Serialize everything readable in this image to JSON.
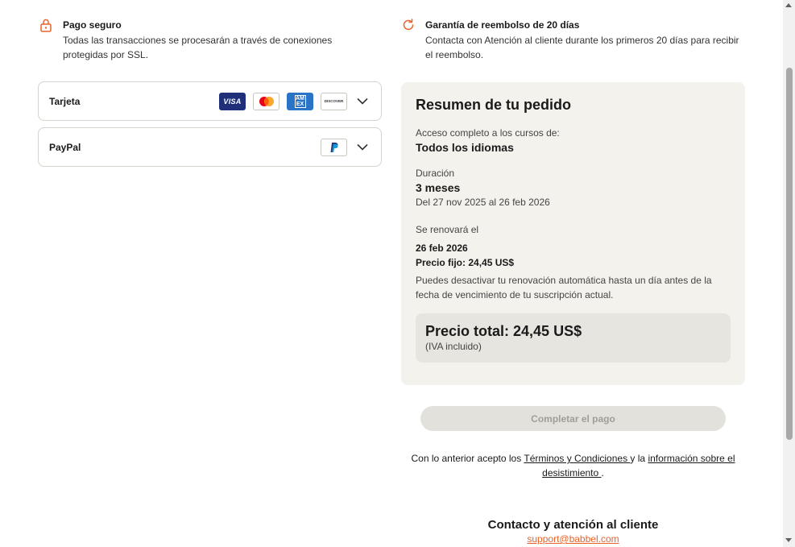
{
  "secure": {
    "title": "Pago seguro",
    "desc": "Todas las transacciones se procesarán a través de conexiones protegidas por SSL."
  },
  "refund": {
    "title": "Garantía de reembolso de 20 días",
    "desc": "Contacta con Atención al cliente durante los primeros 20 días para recibir el reembolso."
  },
  "payment_methods": [
    {
      "label": "Tarjeta",
      "icons": [
        "visa-icon",
        "mastercard-icon",
        "amex-icon",
        "discover-icon"
      ]
    },
    {
      "label": "PayPal",
      "icons": [
        "paypal-icon"
      ]
    }
  ],
  "card_logos": {
    "visa": "VISA",
    "amex": "AM EX",
    "discover": "DISCOVER"
  },
  "summary": {
    "title": "Resumen de tu pedido",
    "access_label": "Acceso completo a los cursos de:",
    "access_value": "Todos los idiomas",
    "duration_label": "Duración",
    "duration_value": "3 meses",
    "duration_dates": "Del 27 nov 2025 al 26 feb 2026",
    "renew_label": "Se renovará el",
    "renew_date": "26 feb 2026",
    "fixed_price": "Precio fijo: 24,45 US$",
    "renew_note": "Puedes desactivar tu renovación automática hasta un día antes de la fecha de vencimiento de tu suscripción actual.",
    "total": "Precio total: 24,45 US$",
    "vat": "(IVA incluido)"
  },
  "pay_button": "Completar el pago",
  "legal": {
    "prefix": "Con lo anterior acepto los ",
    "terms": "Términos y Condiciones ",
    "middle": "y la ",
    "withdrawal": "información sobre el desistimiento ",
    "suffix": "."
  },
  "contact": {
    "title": "Contacto y atención al cliente",
    "email": "support@babbel.com"
  },
  "colors": {
    "accent": "#e8632b",
    "summary_bg": "#f4f2ed",
    "total_bg": "#e7e5df",
    "button_disabled_bg": "#e3e1dc"
  }
}
